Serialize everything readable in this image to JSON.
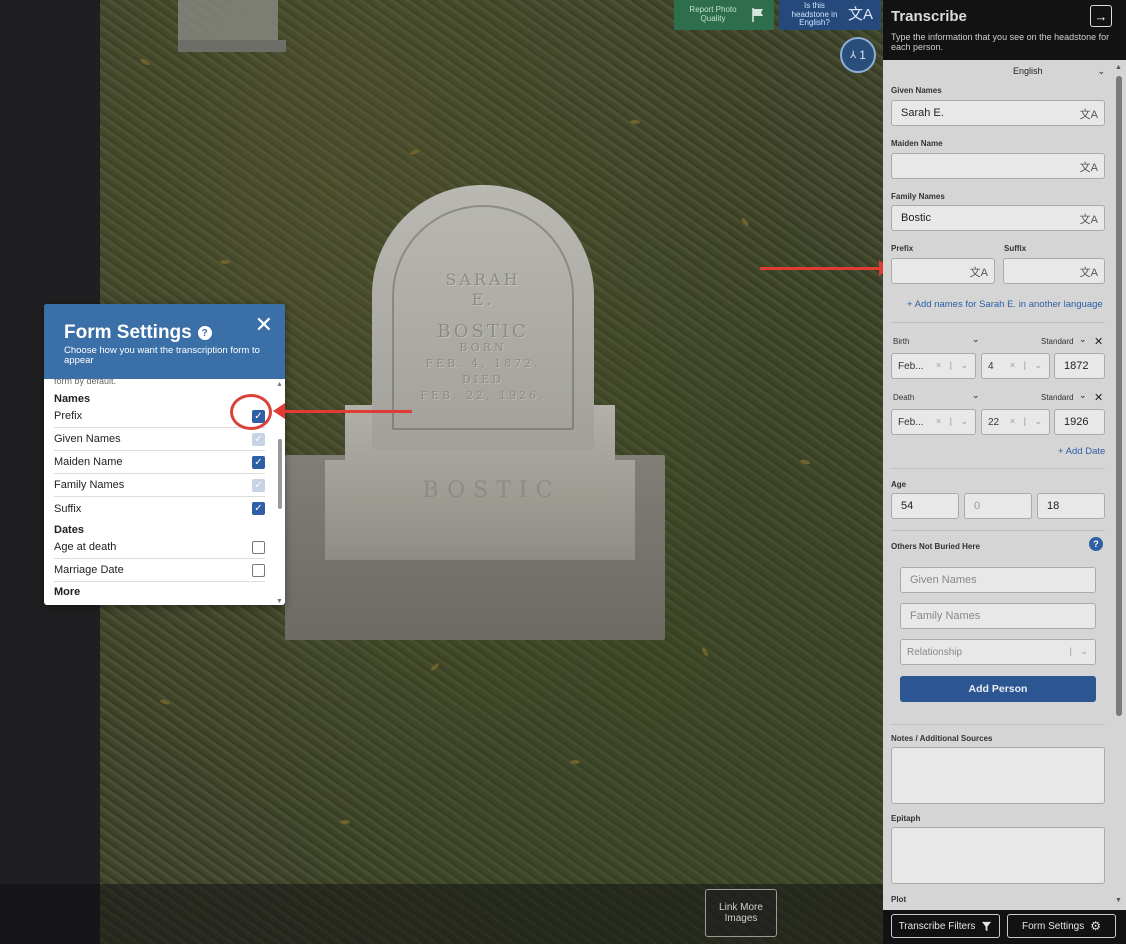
{
  "photo": {
    "report_label": "Report Photo Quality",
    "english_label": "Is this headstone in English?",
    "people_count": "1",
    "link_more_label": "Link More Images",
    "headstone_lines": [
      "SARAH",
      "E.",
      "BOSTIC",
      "BORN",
      "FEB. 4, 1872.",
      "DIED",
      "FEB. 22, 1926."
    ],
    "base_text": "BOSTIC"
  },
  "form_settings": {
    "title": "Form Settings",
    "subtitle": "Choose how you want the transcription form to appear",
    "cut_text": "form by default.",
    "sections": [
      {
        "title": "Names",
        "rows": [
          {
            "label": "Prefix",
            "state": "checked"
          },
          {
            "label": "Given Names",
            "state": "disabled"
          },
          {
            "label": "Maiden Name",
            "state": "checked"
          },
          {
            "label": "Family Names",
            "state": "disabled"
          },
          {
            "label": "Suffix",
            "state": "checked"
          }
        ]
      },
      {
        "title": "Dates",
        "rows": [
          {
            "label": "Age at death",
            "state": "unchecked"
          },
          {
            "label": "Marriage Date",
            "state": "unchecked"
          }
        ]
      },
      {
        "title": "More",
        "rows": []
      }
    ]
  },
  "transcribe": {
    "title": "Transcribe",
    "subtitle": "Type the information that you see on the headstone for each person.",
    "language": "English",
    "given_names_label": "Given Names",
    "given_names_value": "Sarah E.",
    "maiden_name_label": "Maiden Name",
    "maiden_name_value": "",
    "family_names_label": "Family Names",
    "family_names_value": "Bostic",
    "prefix_label": "Prefix",
    "suffix_label": "Suffix",
    "add_names_link": "+ Add names for Sarah E. in another language",
    "birth": {
      "label": "Birth",
      "type": "Standard",
      "month": "Feb...",
      "day": "4",
      "year": "1872"
    },
    "death": {
      "label": "Death",
      "type": "Standard",
      "month": "Feb...",
      "day": "22",
      "year": "1926"
    },
    "add_date_link": "+ Add Date",
    "age_label": "Age",
    "age_values": [
      "54",
      "0",
      "18"
    ],
    "others_label": "Others Not Buried Here",
    "others_given_placeholder": "Given Names",
    "others_family_placeholder": "Family Names",
    "relationship_placeholder": "Relationship",
    "add_person_label": "Add Person",
    "notes_label": "Notes / Additional Sources",
    "epitaph_label": "Epitaph",
    "plot_label": "Plot",
    "filters_label": "Transcribe Filters",
    "form_settings_label": "Form Settings"
  }
}
